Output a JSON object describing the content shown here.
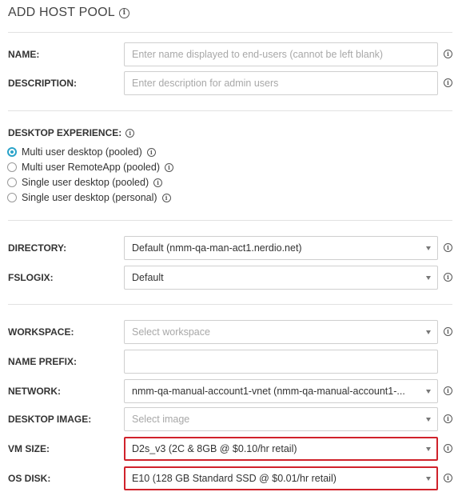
{
  "title": "ADD HOST POOL",
  "info_glyph": "i",
  "fields": {
    "name": {
      "label": "NAME:",
      "placeholder": "Enter name displayed to end-users (cannot be left blank)"
    },
    "description": {
      "label": "DESCRIPTION:",
      "placeholder": "Enter description for admin users"
    },
    "directory": {
      "label": "DIRECTORY:",
      "value": "Default (nmm-qa-man-act1.nerdio.net)"
    },
    "fslogix": {
      "label": "FSLOGIX:",
      "value": "Default"
    },
    "workspace": {
      "label": "WORKSPACE:",
      "placeholder": "Select workspace"
    },
    "name_prefix": {
      "label": "NAME PREFIX:",
      "value": ""
    },
    "network": {
      "label": "NETWORK:",
      "value": "nmm-qa-manual-account1-vnet (nmm-qa-manual-account1-..."
    },
    "desktop_image": {
      "label": "DESKTOP IMAGE:",
      "placeholder": "Select image"
    },
    "vm_size": {
      "label": "VM SIZE:",
      "value": "D2s_v3 (2C & 8GB @ $0.10/hr retail)"
    },
    "os_disk": {
      "label": "OS DISK:",
      "value": "E10 (128 GB Standard SSD @ $0.01/hr retail)"
    }
  },
  "desktop_experience": {
    "label": "DESKTOP EXPERIENCE:",
    "selected": "Multi user desktop (pooled)",
    "options": [
      "Multi user desktop (pooled)",
      "Multi user RemoteApp (pooled)",
      "Single user desktop (pooled)",
      "Single user desktop (personal)"
    ]
  },
  "colors": {
    "highlight_border": "#d0222b",
    "radio_selected": "#2aa3c9"
  },
  "icons": {
    "info": "info-circle-icon",
    "dropdown": "chevron-down-icon"
  }
}
